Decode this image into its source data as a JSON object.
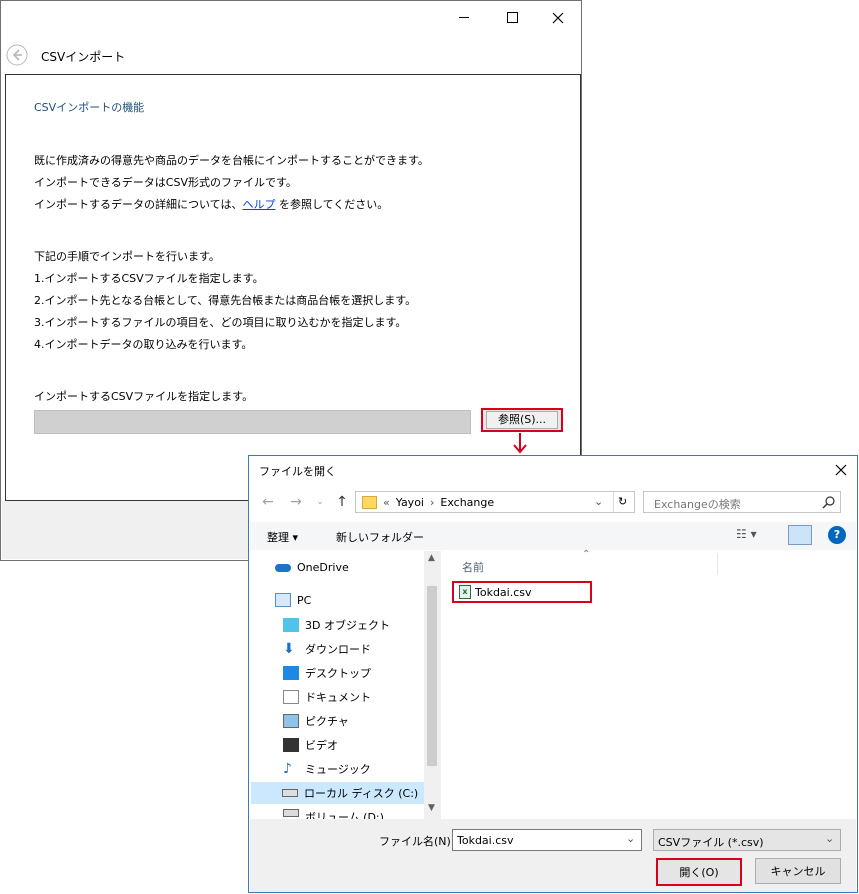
{
  "main_window": {
    "title": "CSVインポート",
    "heading": "CSVインポートの機能",
    "intro_line1": "既に作成済みの得意先や商品のデータを台帳にインポートすることができます。",
    "intro_line2": "インポートできるデータはCSV形式のファイルです。",
    "intro_line3_prefix": "インポートするデータの詳細については、",
    "help_link": "ヘルプ",
    "intro_line3_suffix": " を参照してください。",
    "steps_intro": "下記の手順でインポートを行います。",
    "steps": [
      "1.インポートするCSVファイルを指定します。",
      "2.インポート先となる台帳として、得意先台帳または商品台帳を選択します。",
      "3.インポートするファイルの項目を、どの項目に取り込むかを指定します。",
      "4.インポートデータの取り込みを行います。"
    ],
    "file_prompt": "インポートするCSVファイルを指定します。",
    "file_path_value": "",
    "browse_label": "参照(S)..."
  },
  "dialog": {
    "title": "ファイルを開く",
    "address": {
      "overflow": "«",
      "parts": [
        "Yayoi",
        "Exchange"
      ]
    },
    "search_placeholder": "Exchangeの検索",
    "organize_label": "整理 ▾",
    "new_folder_label": "新しいフォルダー",
    "nav_items": [
      "OneDrive",
      "PC",
      "3D オブジェクト",
      "ダウンロード",
      "デスクトップ",
      "ドキュメント",
      "ピクチャ",
      "ビデオ",
      "ミュージック",
      "ローカル ディスク (C:)",
      "ボリューム (D:)"
    ],
    "column_name": "名前",
    "files": [
      "Tokdai.csv"
    ],
    "filename_label": "ファイル名(N):",
    "filename_value": "Tokdai.csv",
    "filetype_value": "CSVファイル (*.csv)",
    "open_label": "開く(O)",
    "cancel_label": "キャンセル"
  },
  "colors": {
    "highlight": "#d9001b",
    "link": "#0645d9",
    "accent": "#0078d7"
  }
}
